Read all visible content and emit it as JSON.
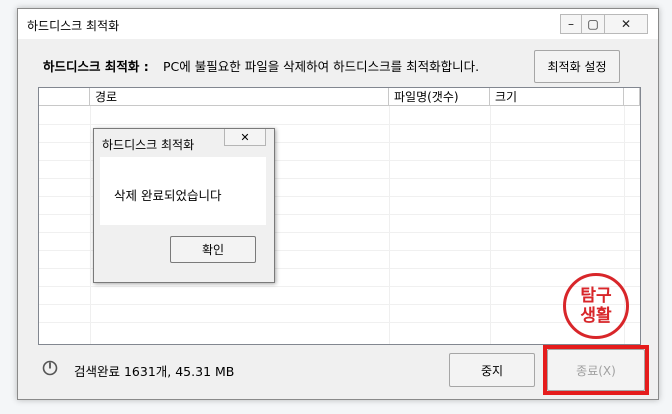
{
  "window": {
    "title": "하드디스크 최적화",
    "min_glyph": "–",
    "max_glyph": "▢",
    "close_glyph": "✕"
  },
  "header": {
    "bold_label": "하드디스크 최적화 :",
    "description": "PC에 불필요한 파일을 삭제하여 하드디스크를 최적화합니다.",
    "settings_button": "최적화 설정"
  },
  "table": {
    "columns": [
      "",
      "경로",
      "파일명(갯수)",
      "크기"
    ]
  },
  "status": {
    "text": "검색완료 1631개, 45.31 MB",
    "icon": "power-icon"
  },
  "buttons": {
    "stop": "중지",
    "close": "종료(X)"
  },
  "dialog": {
    "title": "하드디스크 최적화",
    "close_glyph": "✕",
    "message": "삭제 완료되었습니다",
    "ok": "확인"
  },
  "stamp": {
    "line1": "탐구",
    "line2": "생활"
  },
  "colors": {
    "highlight": "#e51c1c",
    "stamp": "#d8262a"
  }
}
